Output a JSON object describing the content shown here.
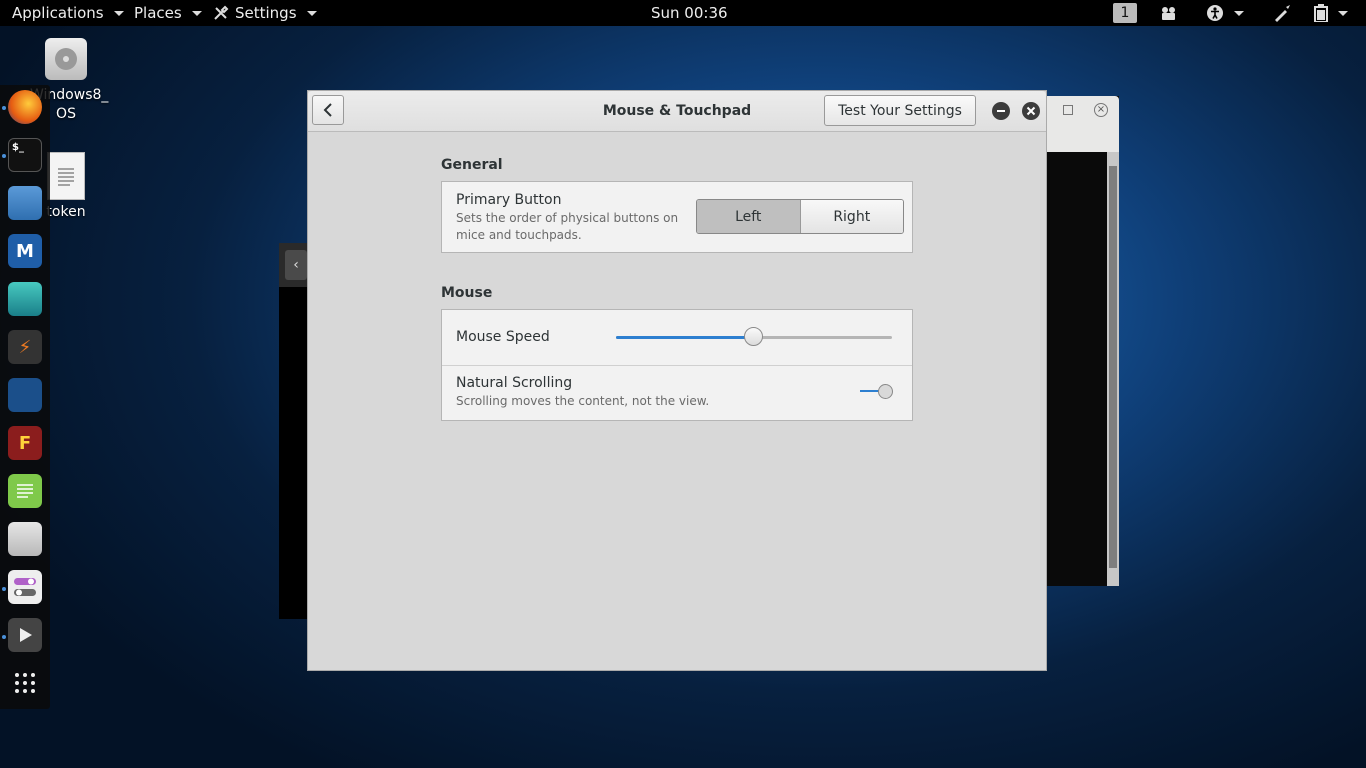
{
  "topbar": {
    "applications": "Applications",
    "places": "Places",
    "settings": "Settings",
    "clock": "Sun 00:36",
    "workspace": "1"
  },
  "desktop": {
    "icons": [
      {
        "label": "Windows8_ OS"
      },
      {
        "label": "token"
      }
    ]
  },
  "dock": {
    "apps": [
      "firefox",
      "terminal",
      "files",
      "metasploit",
      "armitage",
      "burpsuite",
      "maltego",
      "faraday",
      "text-editor",
      "gnome-disks",
      "tweaks",
      "videos",
      "show-apps"
    ]
  },
  "dialog": {
    "title": "Mouse & Touchpad",
    "test_button": "Test Your Settings",
    "general": {
      "heading": "General",
      "primary_button": {
        "title": "Primary Button",
        "subtitle": "Sets the order of physical buttons on mice and touchpads.",
        "options": [
          "Left",
          "Right"
        ],
        "selected": "Left"
      }
    },
    "mouse": {
      "heading": "Mouse",
      "speed": {
        "title": "Mouse Speed",
        "value": 0.5
      },
      "natural_scrolling": {
        "title": "Natural Scrolling",
        "subtitle": "Scrolling moves the content, not the view.",
        "enabled": true
      }
    }
  },
  "colors": {
    "accent": "#2d7fd0",
    "topbar": "#000000",
    "dialog_bg": "#d8d8d8"
  }
}
